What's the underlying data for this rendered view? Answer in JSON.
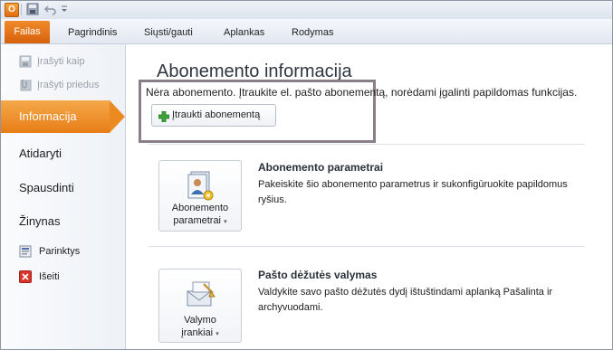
{
  "titlebar": {
    "app_icon": "O",
    "save_icon": "save-icon",
    "undo_icon": "undo-icon"
  },
  "ribbon": {
    "tabs": [
      "Failas",
      "Pagrindinis",
      "Siųsti/gauti",
      "Aplankas",
      "Rodymas"
    ]
  },
  "leftnav": {
    "items": {
      "save_as": "Įrašyti kaip",
      "save_attachments": "Įrašyti priedus",
      "info": "Informacija",
      "open": "Atidaryti",
      "print": "Spausdinti",
      "help": "Žinynas",
      "options": "Parinktys",
      "exit": "Išeiti"
    }
  },
  "main": {
    "title": "Abonemento informacija",
    "notice": "Nėra abonemento. Įtraukite el. pašto abonementą, norėdami įgalinti papildomas funkcijas.",
    "add_account_button": "Įtraukti abonementą",
    "sections": [
      {
        "button_line1": "Abonemento",
        "button_line2": "parametrai",
        "title": "Abonemento parametrai",
        "description": "Pakeiskite šio abonemento parametrus ir sukonfigūruokite papildomus ryšius."
      },
      {
        "button_line1": "Valymo",
        "button_line2": "įrankiai",
        "title": "Pašto dėžutės valymas",
        "description": "Valdykite savo pašto dėžutės dydį ištuštindami aplanką Pašalinta ir archyvuodami."
      }
    ]
  },
  "colors": {
    "accent_orange": "#e77d17",
    "highlight_frame": "#8a7f88"
  }
}
